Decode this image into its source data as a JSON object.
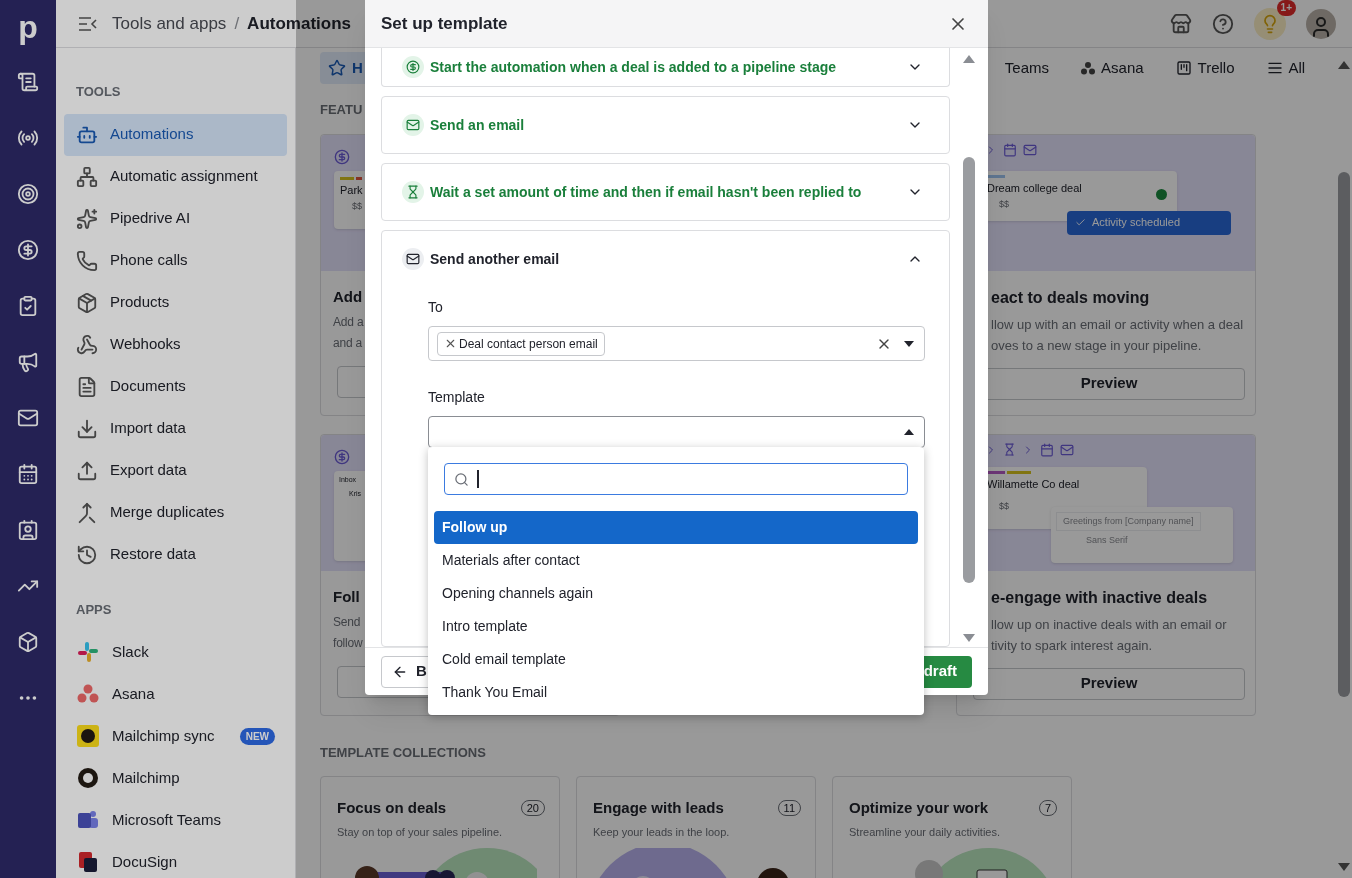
{
  "rail": {
    "logo": "p"
  },
  "header": {
    "breadcrumb": [
      {
        "label": "Tools and apps",
        "current": false
      },
      {
        "label": "Automations",
        "current": true
      }
    ],
    "separator": "/",
    "notification_badge": "1+"
  },
  "sidebar": {
    "sections": [
      {
        "title": "TOOLS",
        "items": [
          {
            "label": "Automations",
            "selected": true
          },
          {
            "label": "Automatic assignment",
            "selected": false
          },
          {
            "label": "Pipedrive AI",
            "selected": false
          },
          {
            "label": "Phone calls",
            "selected": false
          },
          {
            "label": "Products",
            "selected": false
          },
          {
            "label": "Webhooks",
            "selected": false
          },
          {
            "label": "Documents",
            "selected": false
          },
          {
            "label": "Import data",
            "selected": false
          },
          {
            "label": "Export data",
            "selected": false
          },
          {
            "label": "Merge duplicates",
            "selected": false
          },
          {
            "label": "Restore data",
            "selected": false
          }
        ]
      },
      {
        "title": "APPS",
        "items": [
          {
            "label": "Slack",
            "selected": false
          },
          {
            "label": "Asana",
            "selected": false
          },
          {
            "label": "Mailchimp sync",
            "selected": false,
            "badge": "NEW"
          },
          {
            "label": "Mailchimp",
            "selected": false
          },
          {
            "label": "Microsoft Teams",
            "selected": false
          },
          {
            "label": "DocuSign",
            "selected": false
          }
        ]
      }
    ]
  },
  "main": {
    "tabs": [
      {
        "label": "H",
        "selected": true
      },
      {
        "label": "Teams",
        "selected": false
      },
      {
        "label": "Asana",
        "selected": false
      },
      {
        "label": "Trello",
        "selected": false
      },
      {
        "label": "All",
        "selected": false
      }
    ],
    "featured_heading": "FEATU",
    "featured_cards": [
      {
        "kind": "deal",
        "preview_texts": [
          "Park",
          "$$"
        ],
        "title": "Add",
        "description": [
          "Add a",
          "and a"
        ]
      },
      {
        "kind": "deal_activity",
        "preview_texts": [
          "Dream college deal",
          "$$",
          "Activity scheduled"
        ],
        "title": "eact to deals moving",
        "description": [
          "llow up with an email or activity when a deal",
          "oves to a new stage in your pipeline."
        ],
        "button": "Preview"
      },
      {
        "kind": "inbox",
        "preview_texts": [
          "Inbox",
          "Kris"
        ],
        "title": "Foll",
        "description": [
          "Send",
          "follow"
        ]
      },
      {
        "kind": "deal_email",
        "preview_texts": [
          "Willamette Co deal",
          "$$",
          "Greetings from [Company name]",
          "Sans Serif"
        ],
        "title": "e-engage with inactive deals",
        "description": [
          "llow up on inactive deals with an email or",
          "tivity to spark interest again."
        ],
        "button": "Preview"
      }
    ],
    "collections_heading": "TEMPLATE COLLECTIONS",
    "collections": [
      {
        "title": "Focus on deals",
        "subtitle": "Stay on top of your sales pipeline.",
        "count": "20"
      },
      {
        "title": "Engage with leads",
        "subtitle": "Keep your leads in the loop.",
        "count": "11"
      },
      {
        "title": "Optimize your work",
        "subtitle": "Streamline your daily activities.",
        "count": "7"
      }
    ]
  },
  "modal": {
    "title": "Set up template",
    "steps": [
      {
        "kind": "trigger",
        "label": "Start the automation when a deal is added to a pipeline stage",
        "completed": true,
        "expanded": false
      },
      {
        "kind": "email",
        "label": "Send an email",
        "completed": true,
        "expanded": false
      },
      {
        "kind": "wait",
        "label": "Wait a set amount of time and then if email hasn't been replied to",
        "completed": true,
        "expanded": false
      },
      {
        "kind": "email",
        "label": "Send another email",
        "completed": false,
        "expanded": true
      }
    ],
    "to_field": {
      "label": "To",
      "chips": [
        "Deal contact person email"
      ]
    },
    "template_field": {
      "label": "Template",
      "open": true,
      "options": [
        {
          "label": "Follow up",
          "selected": true
        },
        {
          "label": "Materials after contact",
          "selected": false
        },
        {
          "label": "Opening channels again",
          "selected": false
        },
        {
          "label": "Intro template",
          "selected": false
        },
        {
          "label": "Cold email template",
          "selected": false
        },
        {
          "label": "Thank You Email",
          "selected": false
        }
      ]
    },
    "footer": {
      "back": "B",
      "primary": "draft"
    }
  }
}
